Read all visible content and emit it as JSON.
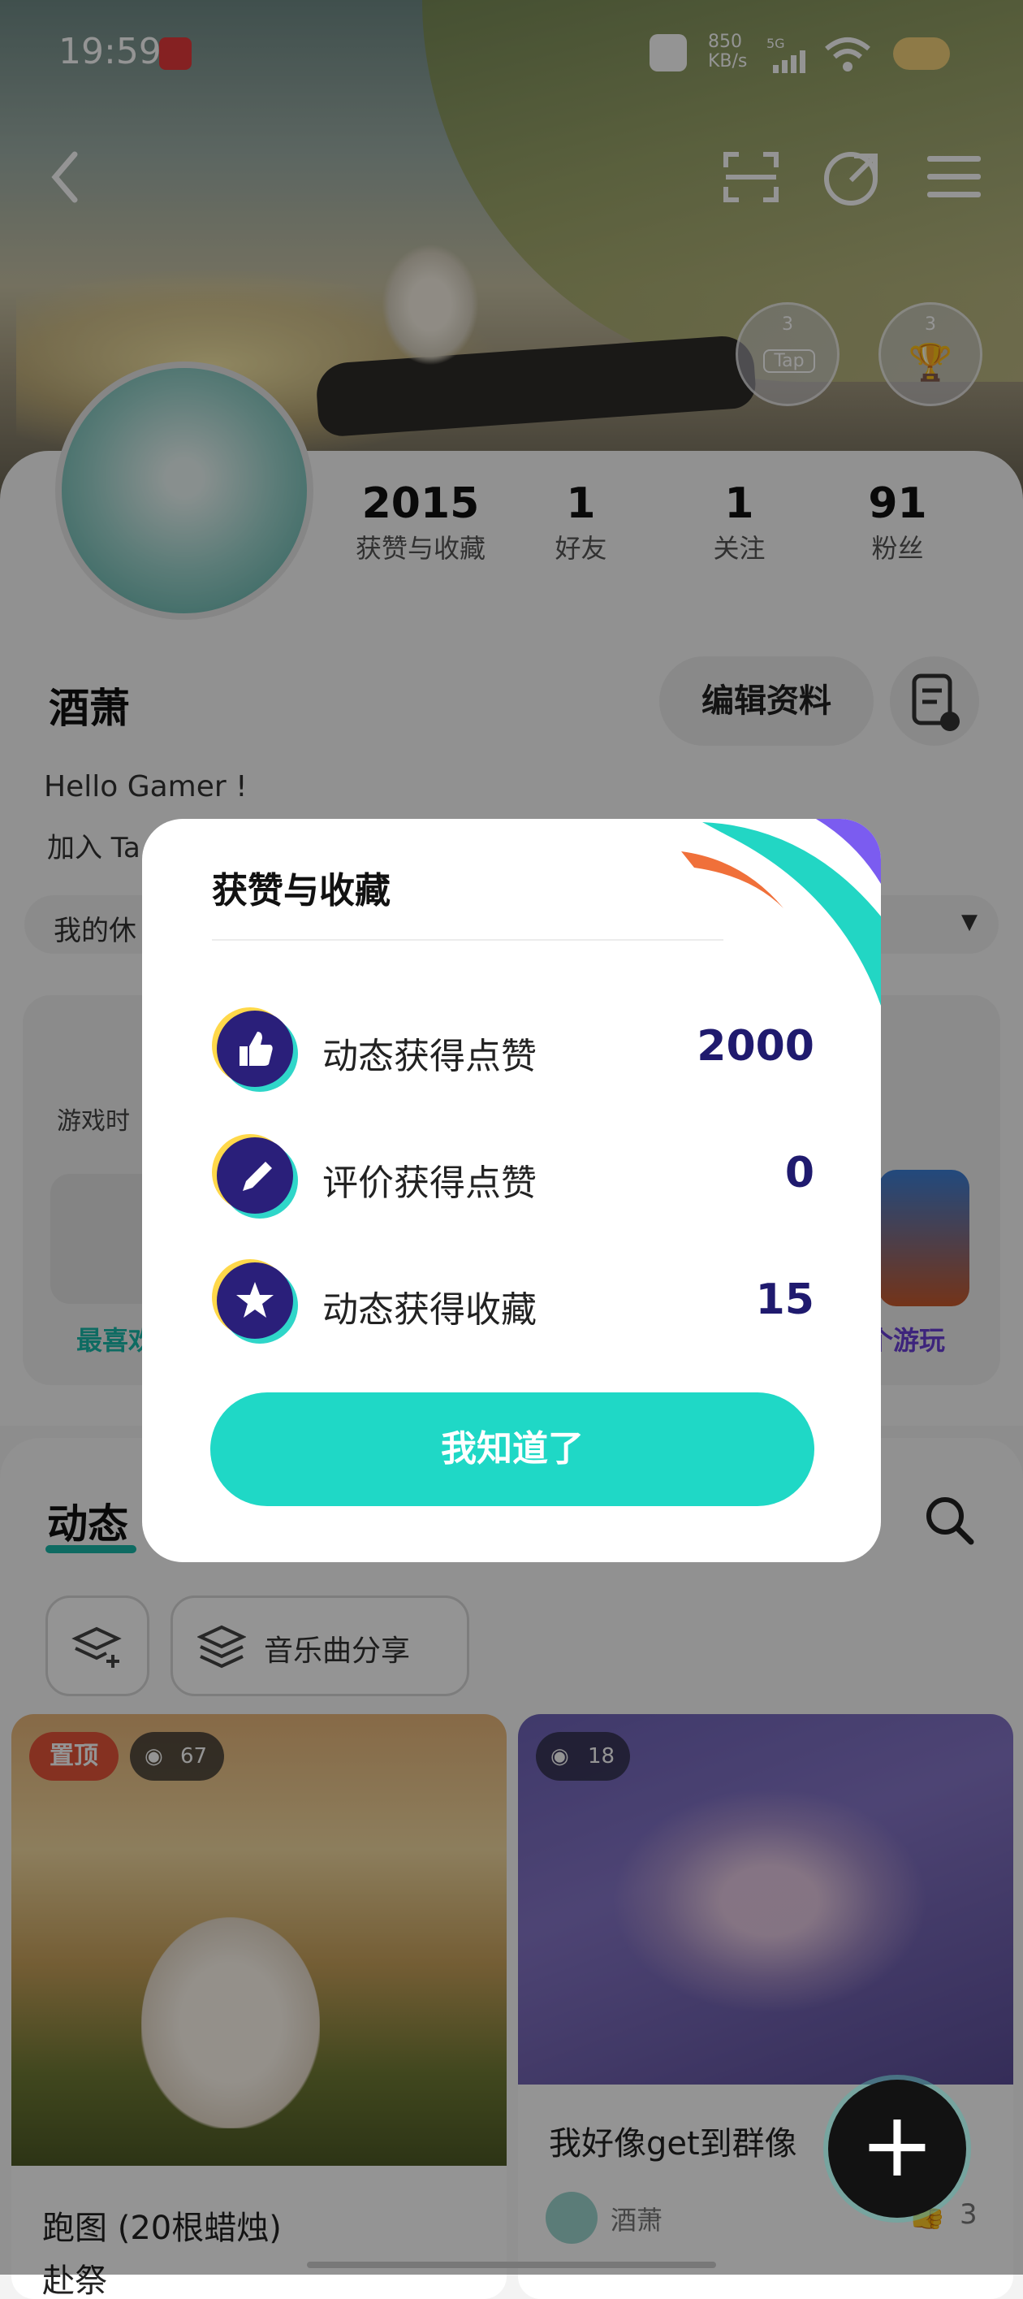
{
  "status_bar": {
    "time": "19:59",
    "net_speed": "850",
    "net_unit": "KB/s",
    "signal": "5G"
  },
  "header": {
    "badge1_level": "3",
    "badge1_label": "Tap",
    "badge2_level": "3"
  },
  "stats": [
    {
      "value": "2015",
      "label": "获赞与收藏"
    },
    {
      "value": "1",
      "label": "好友"
    },
    {
      "value": "1",
      "label": "关注"
    },
    {
      "value": "91",
      "label": "粉丝"
    }
  ],
  "profile": {
    "name": "酒萧",
    "edit_label": "编辑资料",
    "bio": "Hello Gamer !",
    "join_text": "加入 Ta",
    "my_label": "我的休"
  },
  "games": {
    "playtime_label": "游戏时",
    "fav_label": "最喜欢",
    "count_label": "个游玩"
  },
  "feed": {
    "tab": "动态",
    "chip_music": "音乐曲分享",
    "posts": [
      {
        "pinned": "置顶",
        "views": "67",
        "title": "跑图 (20根蜡烛)",
        "subtitle": "赴祭"
      },
      {
        "views": "18",
        "title": "我好像get到群像",
        "author": "酒萧",
        "likes": "3"
      }
    ]
  },
  "modal": {
    "title": "获赞与收藏",
    "rows": [
      {
        "label": "动态获得点赞",
        "value": "2000",
        "icon": "thumbs-up-icon"
      },
      {
        "label": "评价获得点赞",
        "value": "0",
        "icon": "pen-icon"
      },
      {
        "label": "动态获得收藏",
        "value": "15",
        "icon": "star-icon"
      }
    ],
    "ok_label": "我知道了"
  },
  "colors": {
    "accent": "#1fd8c6",
    "value_color": "#1f1a6e",
    "pin_red": "#e5553a"
  }
}
